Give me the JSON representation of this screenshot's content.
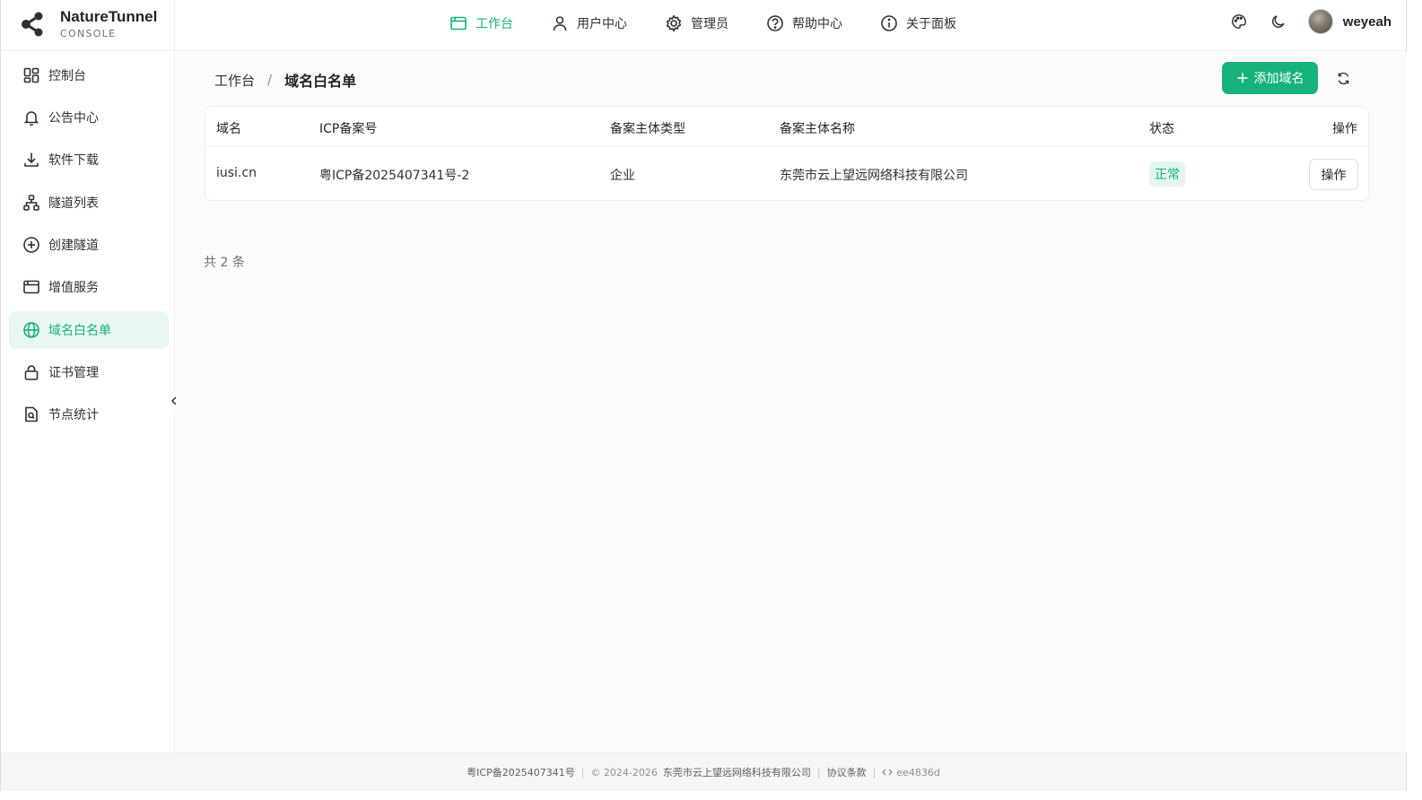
{
  "brand": {
    "name": "NatureTunnel",
    "sub": "CONSOLE"
  },
  "topnav": [
    {
      "label": "工作台",
      "icon": "workbench-icon",
      "active": true
    },
    {
      "label": "用户中心",
      "icon": "user-icon",
      "active": false
    },
    {
      "label": "管理员",
      "icon": "gear-icon",
      "active": false
    },
    {
      "label": "帮助中心",
      "icon": "help-icon",
      "active": false
    },
    {
      "label": "关于面板",
      "icon": "info-icon",
      "active": false
    }
  ],
  "user": {
    "name": "weyeah"
  },
  "sidebar": {
    "items": [
      {
        "label": "控制台",
        "icon": "dashboard-icon"
      },
      {
        "label": "公告中心",
        "icon": "bell-icon"
      },
      {
        "label": "软件下载",
        "icon": "download-icon"
      },
      {
        "label": "隧道列表",
        "icon": "tunnel-tree-icon"
      },
      {
        "label": "创建隧道",
        "icon": "plus-circle-icon"
      },
      {
        "label": "增值服务",
        "icon": "calendar-icon"
      },
      {
        "label": "域名白名单",
        "icon": "globe-icon",
        "active": true
      },
      {
        "label": "证书管理",
        "icon": "lock-icon"
      },
      {
        "label": "节点统计",
        "icon": "file-search-icon"
      }
    ]
  },
  "breadcrumb": {
    "home": "工作台",
    "sep": "/",
    "current": "域名白名单"
  },
  "actions": {
    "add_label": "添加域名"
  },
  "table": {
    "headers": [
      "域名",
      "ICP备案号",
      "备案主体类型",
      "备案主体名称",
      "状态",
      "操作"
    ],
    "rows": [
      {
        "domain": "iusi.cn",
        "icp": "粤ICP备2025407341号-2",
        "type": "企业",
        "name": "东莞市云上望远网络科技有限公司",
        "status": "正常",
        "op": "操作"
      }
    ]
  },
  "total": "共 2 条",
  "footer": {
    "icp": "粤ICP备2025407341号",
    "copyright": "© 2024-2026",
    "company": "东莞市云上望远网络科技有限公司",
    "terms": "协议条款",
    "version": "ee4836d"
  },
  "colors": {
    "accent": "#17b27a",
    "accent_bg": "#e9f7f1"
  }
}
